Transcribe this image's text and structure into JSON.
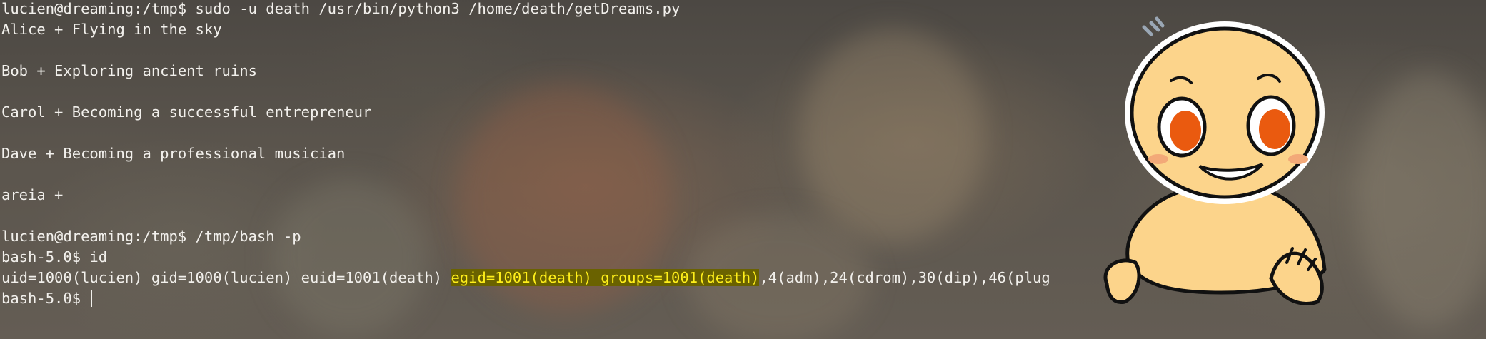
{
  "terminal": {
    "lines": [
      "lucien@dreaming:/tmp$ sudo -u death /usr/bin/python3 /home/death/getDreams.py",
      "Alice + Flying in the sky",
      "",
      "Bob + Exploring ancient ruins",
      "",
      "Carol + Becoming a successful entrepreneur",
      "",
      "Dave + Becoming a professional musician",
      "",
      "areia +",
      "",
      "lucien@dreaming:/tmp$ /tmp/bash -p",
      "bash-5.0$ id"
    ],
    "id_output": {
      "before": "uid=1000(lucien) gid=1000(lucien) euid=1001(death) ",
      "highlighted": "egid=1001(death) groups=1001(death)",
      "after": ",4(adm),24(cdrom),30(dip),46(plug"
    },
    "prompt": "bash-5.0$ "
  },
  "colors": {
    "text": "#f2f0ec",
    "highlight_bg": "#6a6200",
    "highlight_fg": "#ffef1a",
    "mascot_skin": "#fcd48b",
    "mascot_eyes": "#ea5a0f"
  },
  "icons": {
    "overlay": "cartoon-mascot-icon"
  }
}
